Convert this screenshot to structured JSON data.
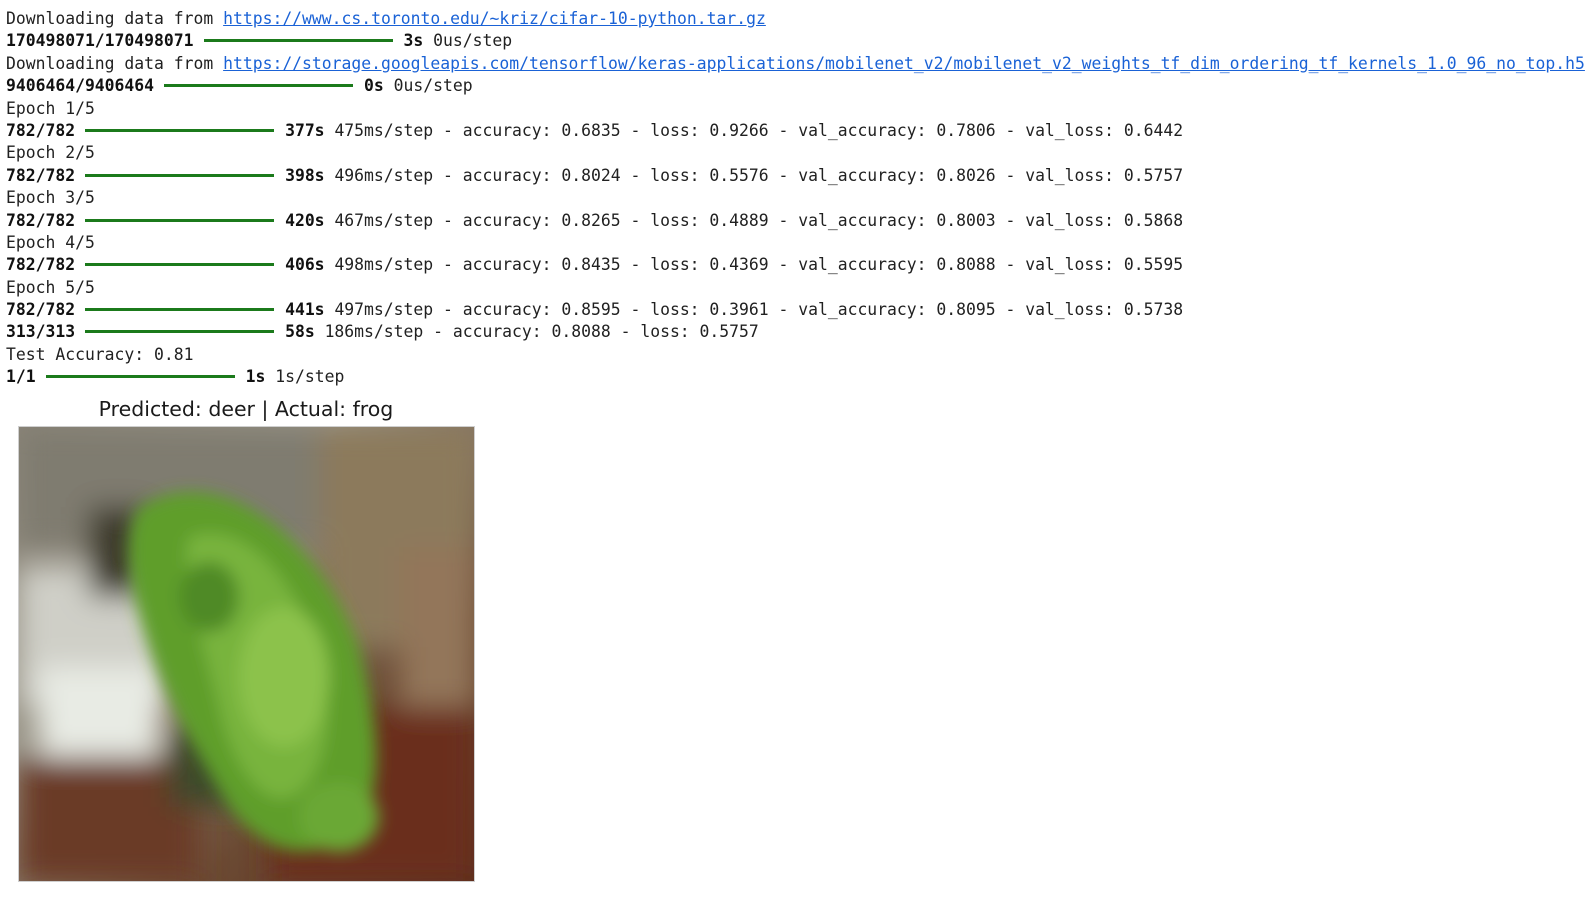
{
  "output": [
    {
      "prefix": "Downloading data from ",
      "url": "https://www.cs.toronto.edu/~kriz/cifar-10-python.tar.gz"
    },
    {
      "count": "170498071/170498071",
      "bar": "long",
      "time": "3s",
      "rest": "0us/step"
    },
    {
      "prefix": "Downloading data from ",
      "url": "https://storage.googleapis.com/tensorflow/keras-applications/mobilenet_v2/mobilenet_v2_weights_tf_dim_ordering_tf_kernels_1.0_96_no_top.h5"
    },
    {
      "count": "9406464/9406464",
      "bar": "long",
      "time": "0s",
      "rest": "0us/step"
    },
    {
      "text": "Epoch 1/5"
    },
    {
      "count": "782/782",
      "bar": "long",
      "time": "377s",
      "rest": "475ms/step - accuracy: 0.6835 - loss: 0.9266 - val_accuracy: 0.7806 - val_loss: 0.6442"
    },
    {
      "text": "Epoch 2/5"
    },
    {
      "count": "782/782",
      "bar": "long",
      "time": "398s",
      "rest": "496ms/step - accuracy: 0.8024 - loss: 0.5576 - val_accuracy: 0.8026 - val_loss: 0.5757"
    },
    {
      "text": "Epoch 3/5"
    },
    {
      "count": "782/782",
      "bar": "long",
      "time": "420s",
      "rest": "467ms/step - accuracy: 0.8265 - loss: 0.4889 - val_accuracy: 0.8003 - val_loss: 0.5868"
    },
    {
      "text": "Epoch 4/5"
    },
    {
      "count": "782/782",
      "bar": "long",
      "time": "406s",
      "rest": "498ms/step - accuracy: 0.8435 - loss: 0.4369 - val_accuracy: 0.8088 - val_loss: 0.5595"
    },
    {
      "text": "Epoch 5/5"
    },
    {
      "count": "782/782",
      "bar": "long",
      "time": "441s",
      "rest": "497ms/step - accuracy: 0.8595 - loss: 0.3961 - val_accuracy: 0.8095 - val_loss: 0.5738"
    },
    {
      "count": "313/313",
      "bar": "long",
      "time": "58s",
      "rest": "186ms/step - accuracy: 0.8088 - loss: 0.5757"
    },
    {
      "text": "Test Accuracy: 0.81"
    },
    {
      "count": "1/1",
      "bar": "long",
      "time": "1s",
      "rest": "1s/step"
    }
  ],
  "figure": {
    "title": "Predicted: deer | Actual: frog",
    "image_subject": "blurry-green-frog-photo"
  },
  "colors": {
    "link": "#1a62d6",
    "progress_bar": "#1b7a1b",
    "text": "#212121"
  }
}
